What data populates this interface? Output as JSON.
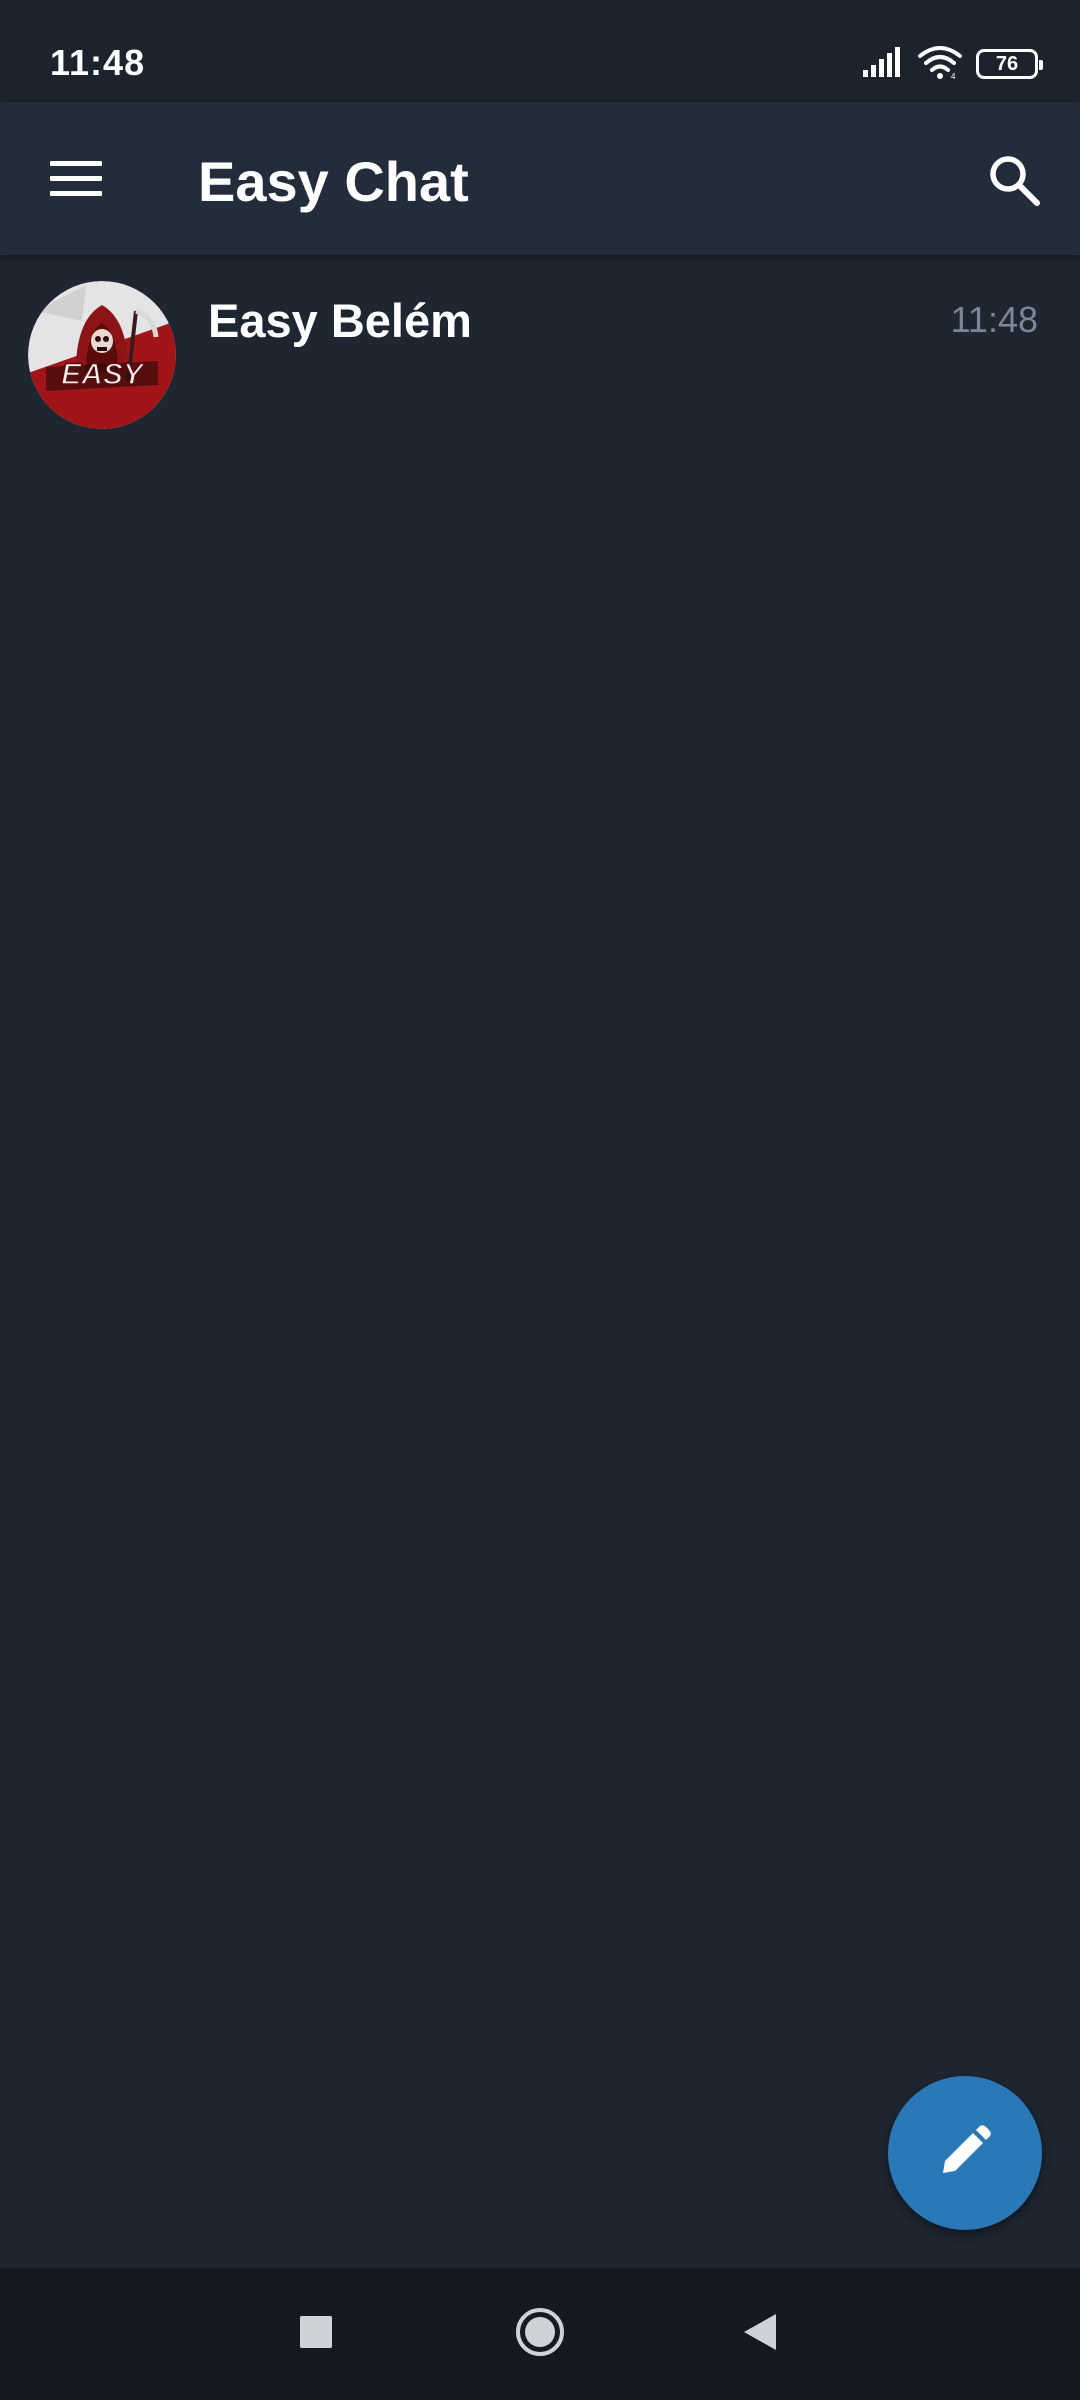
{
  "status_bar": {
    "time": "11:48",
    "battery_level": "76",
    "icons": [
      "signal-icon",
      "wifi-icon",
      "battery-icon"
    ]
  },
  "app_bar": {
    "title": "Easy Chat",
    "menu_icon": "hamburger-menu-icon",
    "search_icon": "search-icon"
  },
  "chats": [
    {
      "name": "Easy Belém",
      "time": "11:48",
      "avatar_icon": "easy-reaper-logo-avatar",
      "avatar_text": "EASY"
    }
  ],
  "fab": {
    "icon": "pencil-icon"
  },
  "nav_bar": {
    "icons": [
      "recents-square-icon",
      "home-circle-icon",
      "back-triangle-icon"
    ]
  },
  "colors": {
    "background": "#1e2632",
    "app_bar": "#222c3a",
    "status_bar": "#1d232d",
    "nav_bar": "#151a22",
    "accent": "#2b78b6",
    "secondary_text": "#7c8793",
    "avatar_red": "#a11518"
  }
}
